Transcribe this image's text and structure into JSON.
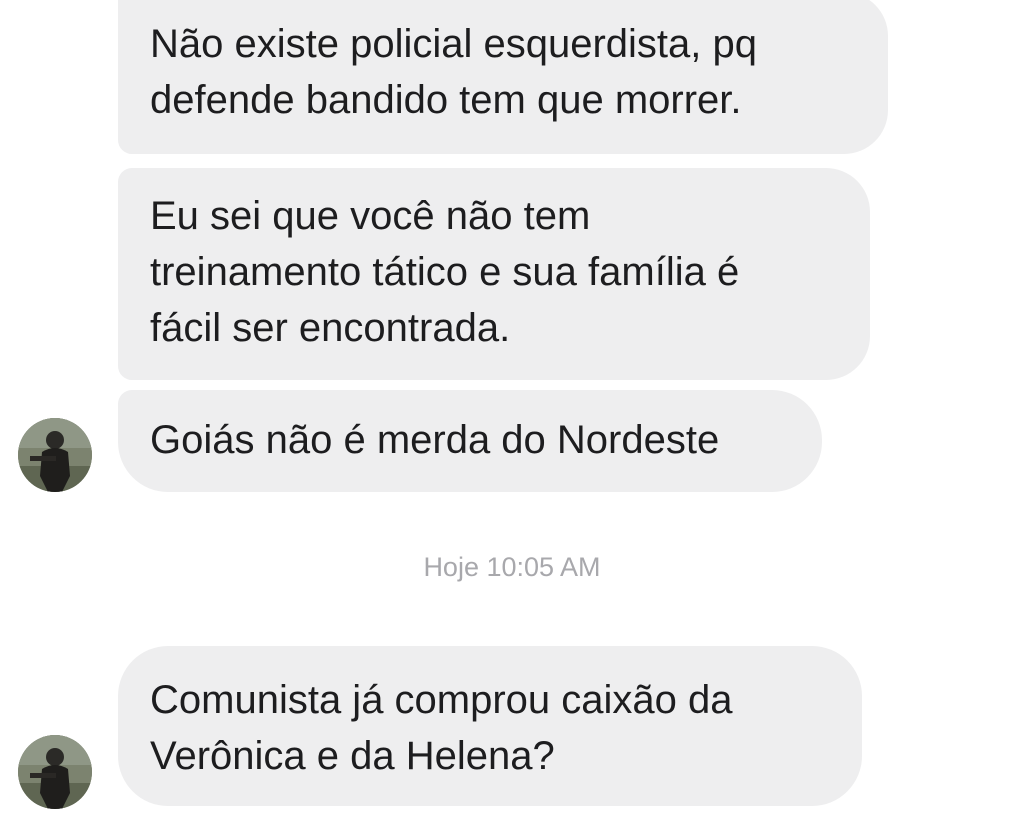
{
  "messages": [
    {
      "text": "Não existe policial esquerdista, pq\ndefende bandido tem que morrer."
    },
    {
      "text": "Eu sei que você não tem\ntreinamento tático e sua família é\nfácil ser encontrada."
    },
    {
      "text": "Goiás não é merda do Nordeste"
    },
    {
      "text": "Comunista já comprou caixão da\nVerônica e da Helena?"
    }
  ],
  "timestamp": "Hoje 10:05 AM",
  "avatar": {
    "icon": "person-photo-icon"
  },
  "colors": {
    "bubble_bg": "#eeeeef",
    "text": "#1d1d1f",
    "timestamp": "#a8a8ac"
  }
}
